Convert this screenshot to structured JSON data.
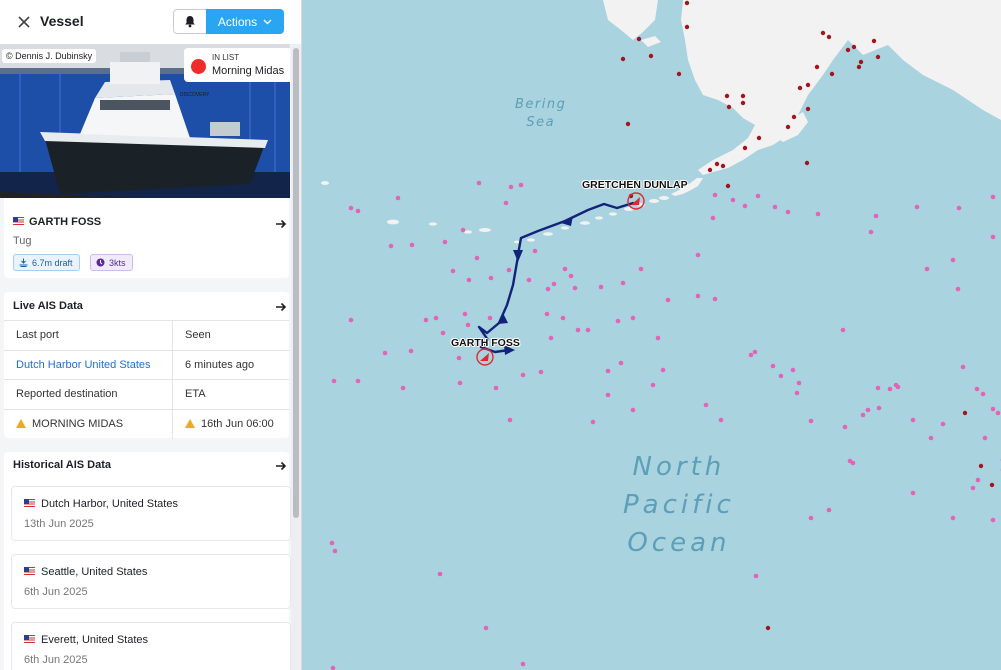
{
  "sidebar": {
    "title": "Vessel",
    "actions_label": "Actions",
    "photo": {
      "credit": "© Dennis J. Dubinsky",
      "list_label": "IN LIST",
      "list_name": "Morning Midas"
    },
    "vessel": {
      "name": "GARTH FOSS",
      "type": "Tug",
      "draft": "6.7m draft",
      "speed": "3kts"
    },
    "live_ais": {
      "title": "Live AIS Data",
      "rows": [
        {
          "c1": "Last port",
          "c2": "Seen"
        },
        {
          "c1": "Dutch Harbor United States",
          "c2": "6 minutes ago"
        },
        {
          "c1": "Reported destination",
          "c2": "ETA"
        },
        {
          "c1": "MORNING MIDAS",
          "c2": "16th Jun 06:00"
        }
      ]
    },
    "historical": {
      "title": "Historical AIS Data",
      "items": [
        {
          "port": "Dutch Harbor, United States",
          "date": "13th Jun 2025"
        },
        {
          "port": "Seattle, United States",
          "date": "6th Jun 2025"
        },
        {
          "port": "Everett, United States",
          "date": "6th Jun 2025"
        }
      ]
    }
  },
  "map": {
    "labels": {
      "bering_1": "Bering",
      "bering_2": "Sea",
      "np_1": "North",
      "np_2": "Pacific",
      "np_3": "Ocean"
    },
    "vessels": {
      "primary": "GARTH FOSS",
      "secondary": "GRETCHEN DUNLAP"
    },
    "colors": {
      "water": "#a9d3df",
      "land": "#f2f2f2",
      "track": "#14237a",
      "vessel_dot": "#e364b6",
      "port_dot": "#a3141c"
    }
  }
}
